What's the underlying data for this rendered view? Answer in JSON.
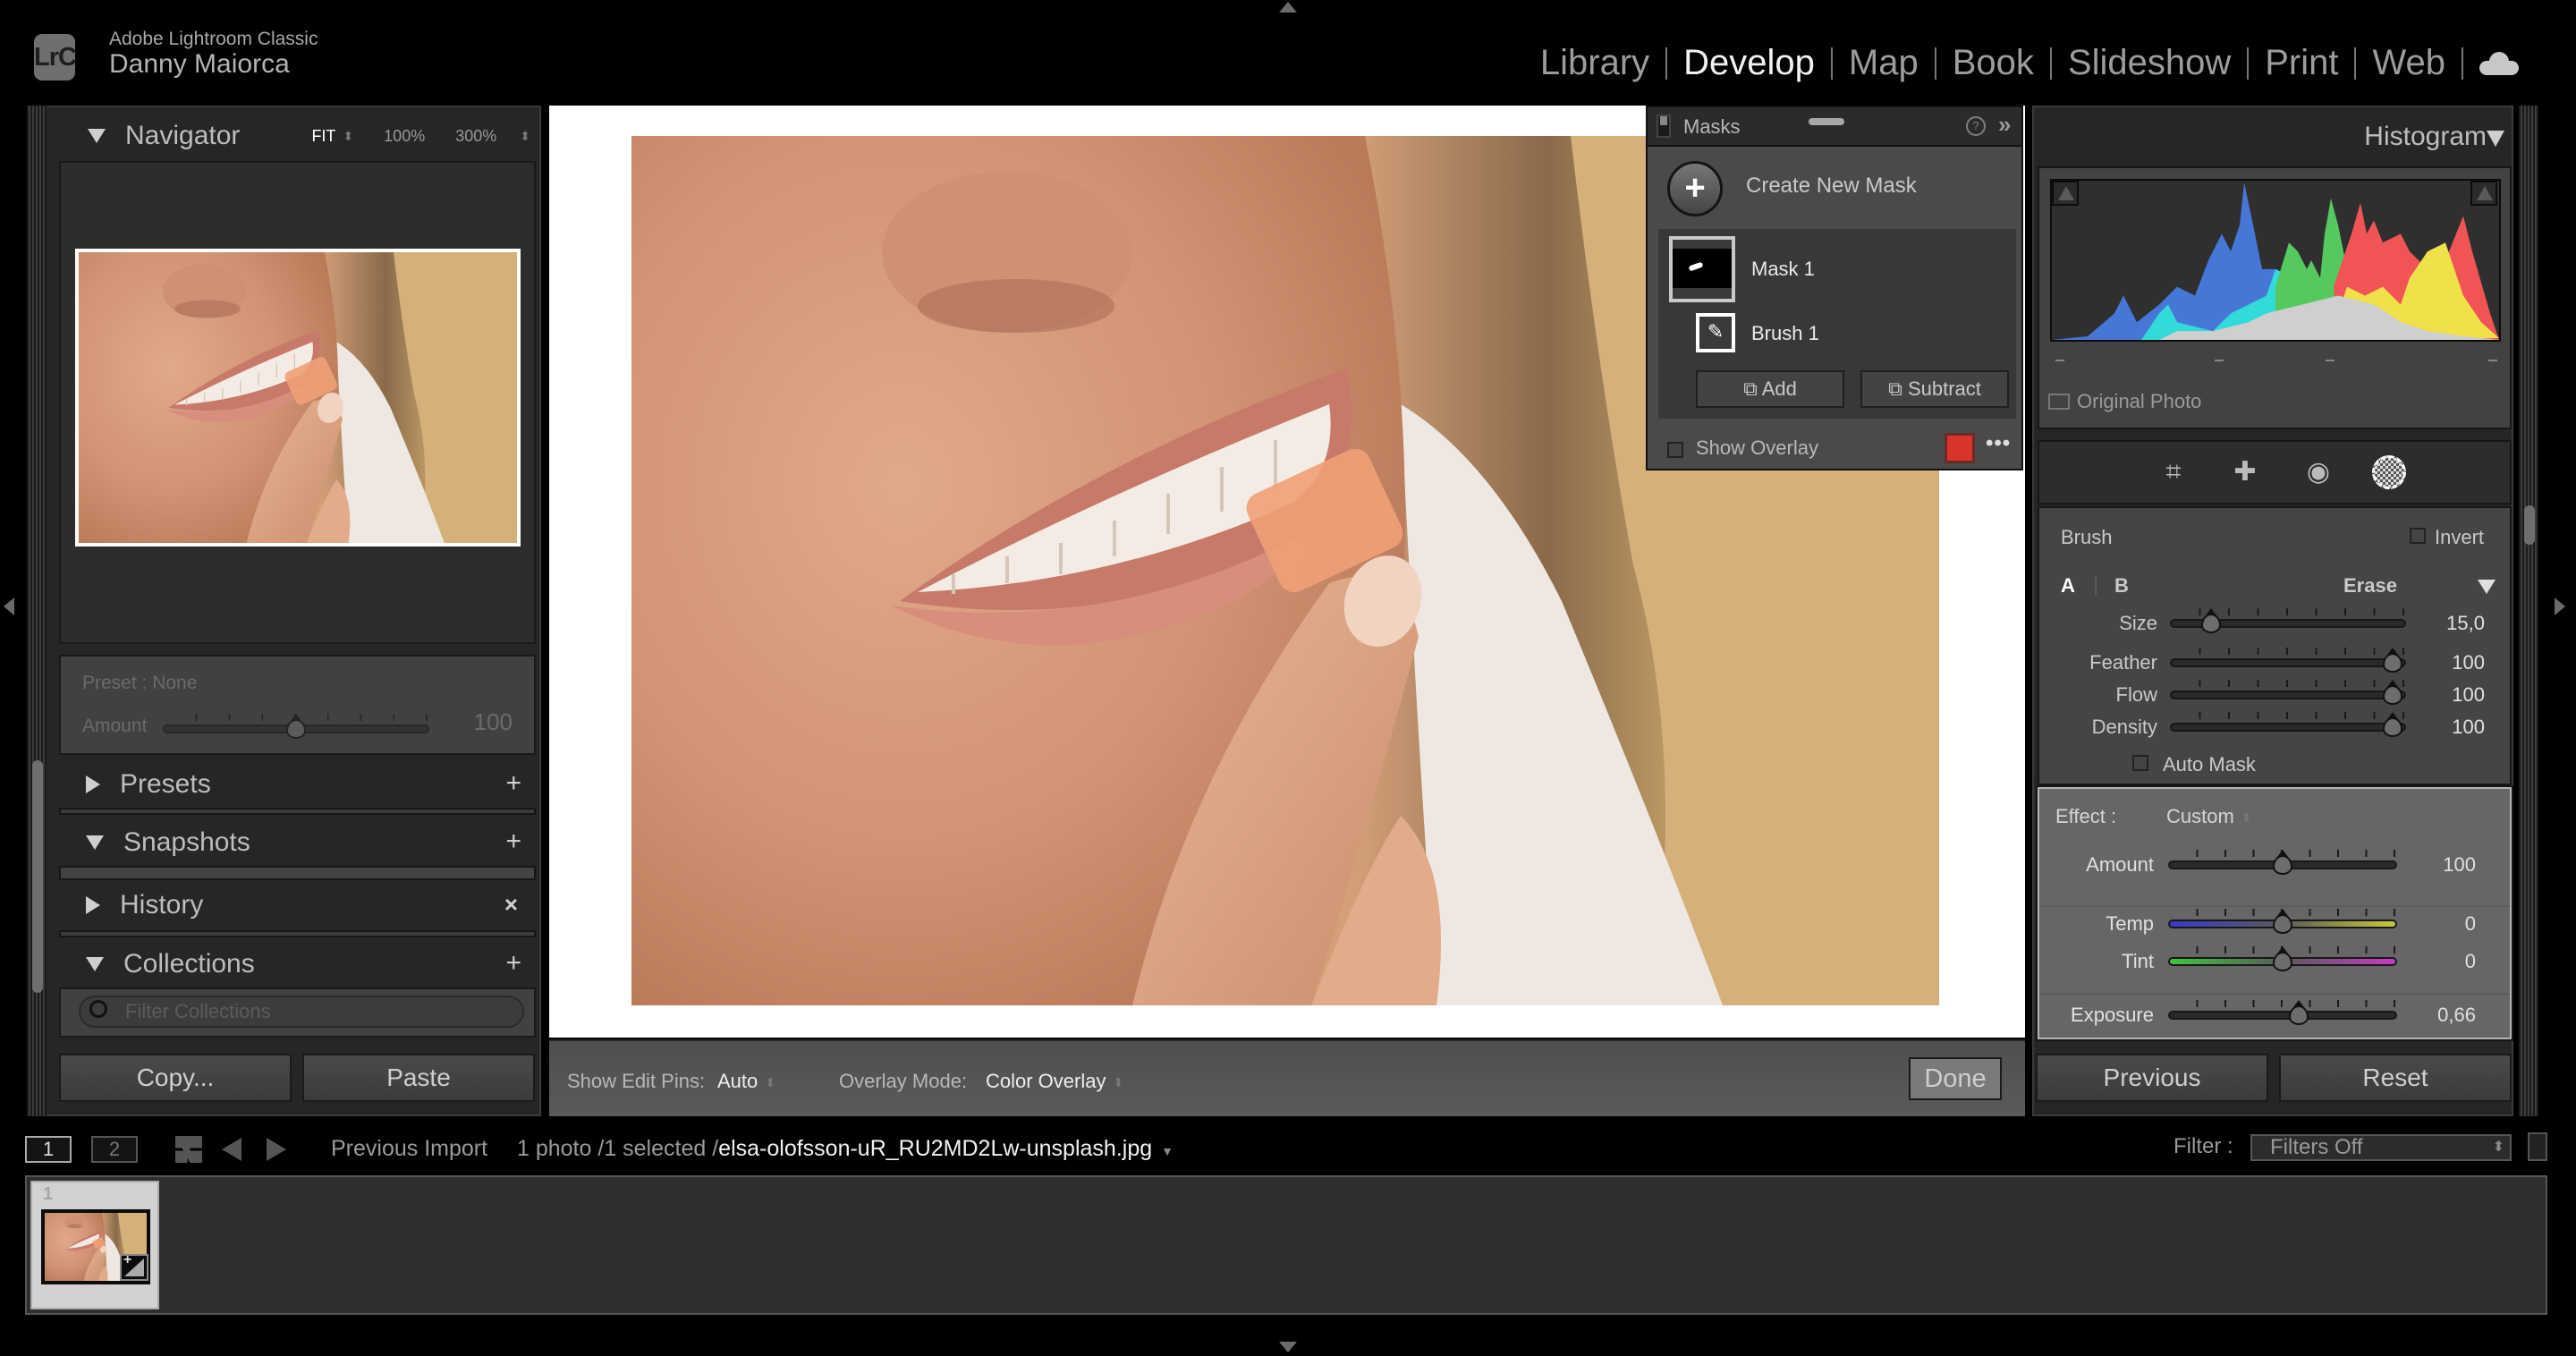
{
  "app": {
    "logo_text": "LrC",
    "app_name": "Adobe Lightroom Classic",
    "user_name": "Danny Maiorca"
  },
  "modules": [
    {
      "label": "Library",
      "active": false
    },
    {
      "label": "Develop",
      "active": true
    },
    {
      "label": "Map",
      "active": false
    },
    {
      "label": "Book",
      "active": false
    },
    {
      "label": "Slideshow",
      "active": false
    },
    {
      "label": "Print",
      "active": false
    },
    {
      "label": "Web",
      "active": false
    }
  ],
  "left_panel": {
    "navigator": {
      "title": "Navigator",
      "zoom_options": [
        "FIT",
        "100%",
        "300%"
      ],
      "selected_zoom": "FIT"
    },
    "preset": {
      "label": "Preset : None",
      "amount_label": "Amount",
      "amount_value": "100",
      "amount_fraction": 0.5
    },
    "sections": [
      {
        "title": "Presets",
        "expanded": false,
        "action": "+"
      },
      {
        "title": "Snapshots",
        "expanded": true,
        "action": "+"
      },
      {
        "title": "History",
        "expanded": false,
        "action": "×"
      },
      {
        "title": "Collections",
        "expanded": true,
        "action": "+"
      }
    ],
    "collections_filter_placeholder": "Filter Collections",
    "copy_button": "Copy...",
    "paste_button": "Paste"
  },
  "center_toolbar": {
    "show_edit_pins_label": "Show Edit Pins:",
    "show_edit_pins_value": "Auto",
    "overlay_mode_label": "Overlay Mode:",
    "overlay_mode_value": "Color Overlay",
    "done_button": "Done"
  },
  "masks_panel": {
    "title": "Masks",
    "help": "?",
    "collapse": "»",
    "create_new_mask": "Create New Mask",
    "masks": [
      {
        "name": "Mask 1",
        "components": [
          {
            "name": "Brush 1",
            "type": "brush"
          }
        ]
      }
    ],
    "add_button": "Add",
    "subtract_button": "Subtract",
    "show_overlay_label": "Show Overlay",
    "show_overlay_checked": false,
    "overlay_color": "#d9342b",
    "more": "•••"
  },
  "right_panel": {
    "histogram": {
      "title": "Histogram",
      "original_photo_label": "Original Photo",
      "original_photo_checked": false
    },
    "tools": [
      "crop-tool",
      "healing-tool",
      "red-eye-tool",
      "masking-tool"
    ],
    "brush": {
      "title": "Brush",
      "invert_label": "Invert",
      "invert_checked": false,
      "brush_a": "A",
      "brush_b": "B",
      "erase_label": "Erase",
      "sliders": [
        {
          "label": "Size",
          "value": "15,0",
          "fraction": 0.17
        },
        {
          "label": "Feather",
          "value": "100",
          "fraction": 0.95
        },
        {
          "label": "Flow",
          "value": "100",
          "fraction": 0.95
        },
        {
          "label": "Density",
          "value": "100",
          "fraction": 0.95
        }
      ],
      "auto_mask_label": "Auto Mask",
      "auto_mask_checked": false
    },
    "effect": {
      "label": "Effect :",
      "value": "Custom",
      "amount": {
        "label": "Amount",
        "value": "100",
        "fraction": 0.5
      },
      "temp": {
        "label": "Temp",
        "value": "0",
        "fraction": 0.5
      },
      "tint": {
        "label": "Tint",
        "value": "0",
        "fraction": 0.5
      },
      "exposure": {
        "label": "Exposure",
        "value": "0,66",
        "fraction": 0.57
      }
    },
    "previous_button": "Previous",
    "reset_button": "Reset"
  },
  "filmstrip": {
    "view1": "1",
    "view2": "2",
    "source": "Previous Import",
    "count_text": "1 photo /1 selected /",
    "filename": "elsa-olofsson-uR_RU2MD2Lw-unsplash.jpg",
    "filter_label": "Filter :",
    "filter_value": "Filters Off",
    "items": [
      {
        "index": "1",
        "has_adjustments": true
      }
    ]
  }
}
